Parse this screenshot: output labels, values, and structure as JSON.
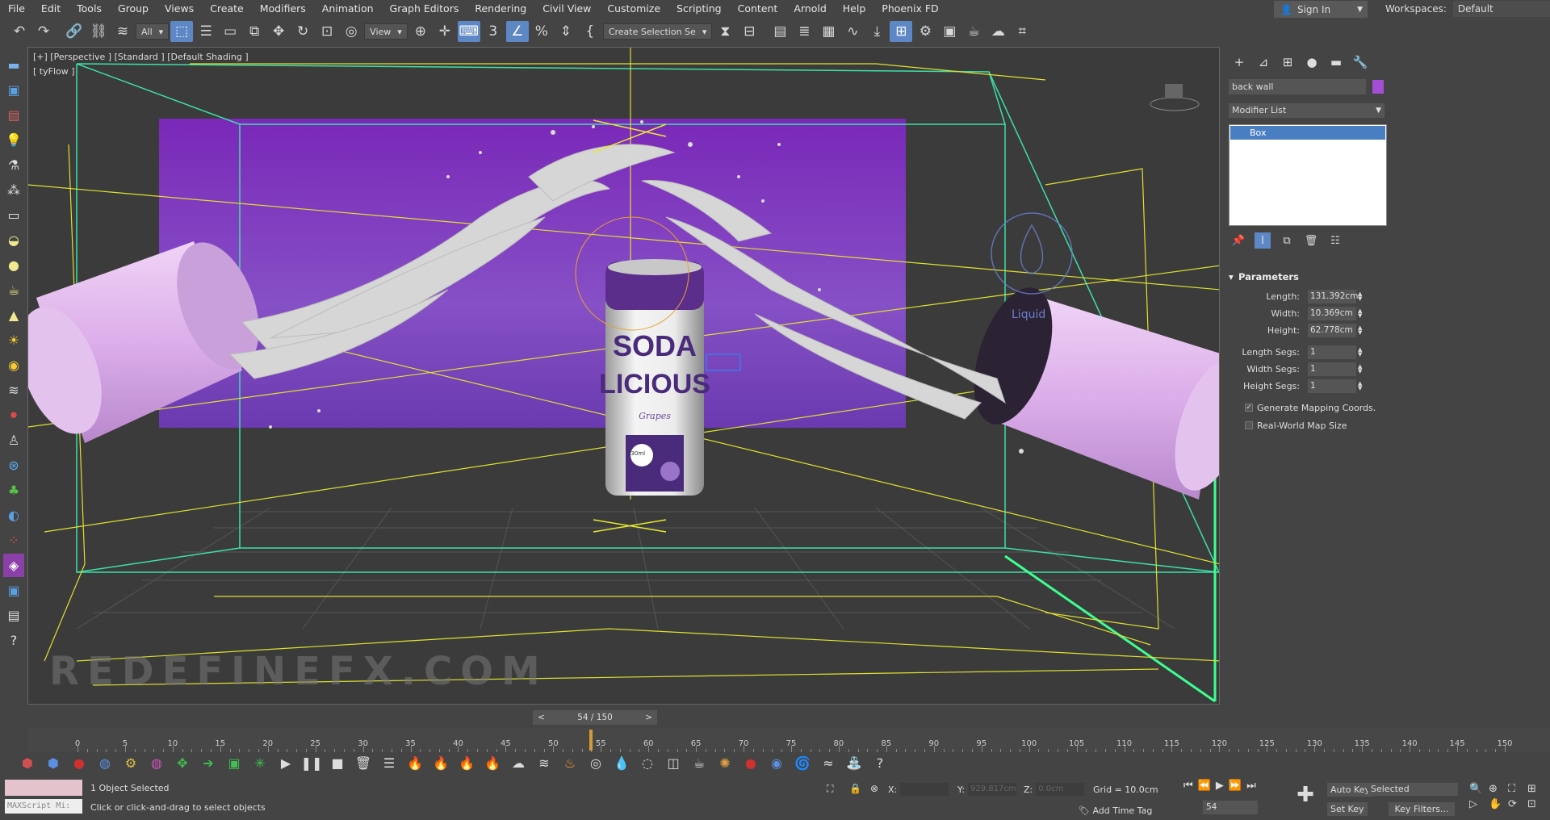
{
  "menu": [
    "File",
    "Edit",
    "Tools",
    "Group",
    "Views",
    "Create",
    "Modifiers",
    "Animation",
    "Graph Editors",
    "Rendering",
    "Civil View",
    "Customize",
    "Scripting",
    "Content",
    "Arnold",
    "Help",
    "Phoenix FD"
  ],
  "account": {
    "sign_in": "Sign In",
    "workspaces_label": "Workspaces:",
    "workspace_value": "Default"
  },
  "toolbar": {
    "filter_combo": "All",
    "view_combo": "View",
    "selection_set": "Create Selection Se"
  },
  "viewport": {
    "label": "[+] [Perspective ] [Standard ] [Default Shading ]",
    "sublabel": "[ tyFlow ]",
    "watermark": "REDEFINEFX.COM",
    "liquid_label": "Liquid",
    "can_title_1": "SODA",
    "can_title_2": "LICIOUS",
    "can_flavor": "Grapes",
    "can_volume": "330ml",
    "background_color": "#7d2fb0",
    "cylinder_color": "#e6bff0"
  },
  "command_panel": {
    "object_name": "back wall",
    "object_color": "#a24fd6",
    "modifier_list": "Modifier List",
    "stack_item": "Box",
    "rollout_title": "Parameters",
    "params": [
      {
        "label": "Length:",
        "value": "131.392cm"
      },
      {
        "label": "Width:",
        "value": "10.369cm"
      },
      {
        "label": "Height:",
        "value": "62.778cm"
      },
      {
        "label": "Length Segs:",
        "value": "1"
      },
      {
        "label": "Width Segs:",
        "value": "1"
      },
      {
        "label": "Height Segs:",
        "value": "1"
      }
    ],
    "checkboxes": [
      {
        "label": "Generate Mapping Coords.",
        "checked": true
      },
      {
        "label": "Real-World Map Size",
        "checked": false
      }
    ]
  },
  "timeline": {
    "time_slider": "54 / 150",
    "current_frame": 54,
    "total_frames": 150,
    "tick_labels": [
      "0",
      "5",
      "10",
      "15",
      "20",
      "25",
      "30",
      "35",
      "40",
      "45",
      "50",
      "55",
      "60",
      "65",
      "70",
      "75",
      "80",
      "85",
      "90",
      "95",
      "100",
      "105",
      "110",
      "115",
      "120",
      "125",
      "130",
      "135",
      "140",
      "145",
      "150"
    ]
  },
  "status": {
    "maxscript": "MAXScript Mi:",
    "selection_count": "1 Object Selected",
    "prompt": "Click or click-and-drag to select objects",
    "x_label": "X:",
    "y_label": "Y:",
    "y_value": "929.817cm",
    "z_label": "Z:",
    "z_value": "0.0cm",
    "grid": "Grid = 10.0cm",
    "add_time_tag": "Add Time Tag",
    "frame_field": "54",
    "auto_key": "Auto Key",
    "set_key": "Set Key",
    "selected_dropdown": "Selected",
    "key_filters": "Key Filters..."
  }
}
